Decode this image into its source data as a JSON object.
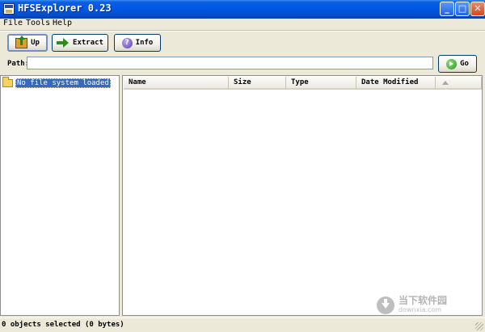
{
  "window": {
    "title": "HFSExplorer 0.23",
    "controls": {
      "minimize": "_",
      "maximize": "□",
      "close": "✕"
    }
  },
  "menu": {
    "file": "File",
    "tools": "Tools",
    "help": "Help"
  },
  "toolbar": {
    "up_label": "Up",
    "extract_label": "Extract",
    "info_label": "Info",
    "info_icon_glyph": "?"
  },
  "path": {
    "label": "Path:",
    "value": "",
    "go_label": "Go"
  },
  "tree": {
    "items": [
      {
        "label": "No file system loaded",
        "icon": "folder-icon",
        "selected": true
      }
    ]
  },
  "file_table": {
    "columns": [
      "Name",
      "Size",
      "Type",
      "Date Modified"
    ],
    "rows": []
  },
  "status": {
    "text": "0 objects selected (0 bytes)"
  },
  "watermark": {
    "main": "当下软件园",
    "sub": "downxia.com"
  },
  "colors": {
    "titlebar": "#0058e6",
    "selection": "#316ac5",
    "window_bg": "#ece9d8"
  }
}
